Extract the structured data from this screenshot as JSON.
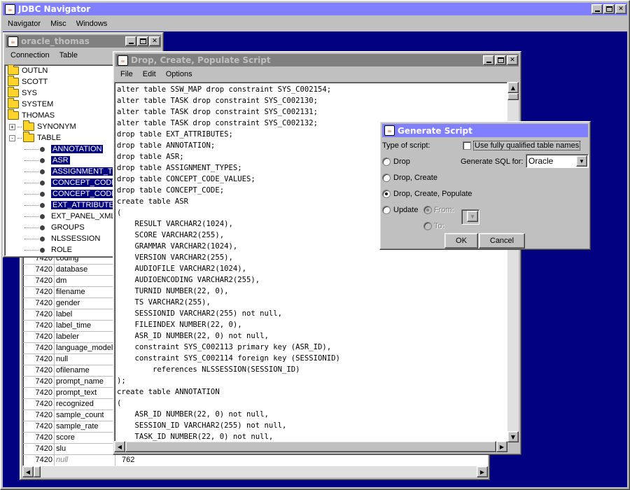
{
  "main": {
    "title": "JDBC Navigator",
    "menu": [
      "Navigator",
      "Misc",
      "Windows"
    ]
  },
  "oracle": {
    "title": "oracle_thomas",
    "menu": [
      "Connection",
      "Table"
    ],
    "tree": [
      {
        "label": "OUTLN",
        "kind": "folder",
        "level": 0
      },
      {
        "label": "SCOTT",
        "kind": "folder",
        "level": 0
      },
      {
        "label": "SYS",
        "kind": "folder",
        "level": 0
      },
      {
        "label": "SYSTEM",
        "kind": "folder",
        "level": 0
      },
      {
        "label": "THOMAS",
        "kind": "folder",
        "level": 0
      },
      {
        "label": "SYNONYM",
        "kind": "folder",
        "level": 1,
        "expander": "+"
      },
      {
        "label": "TABLE",
        "kind": "folder",
        "level": 1,
        "expander": "-"
      },
      {
        "label": "ANNOTATION",
        "kind": "leaf",
        "selected": true
      },
      {
        "label": "ASR",
        "kind": "leaf",
        "selected": true
      },
      {
        "label": "ASSIGNMENT_TYPES",
        "kind": "leaf",
        "selected": true
      },
      {
        "label": "CONCEPT_CODE",
        "kind": "leaf",
        "selected": true
      },
      {
        "label": "CONCEPT_CODE_VALUES",
        "kind": "leaf",
        "selected": true
      },
      {
        "label": "EXT_ATTRIBUTES",
        "kind": "leaf",
        "selected": true
      },
      {
        "label": "EXT_PANEL_XML",
        "kind": "leaf",
        "selected": false
      },
      {
        "label": "GROUPS",
        "kind": "leaf",
        "selected": false
      },
      {
        "label": "NLSSESSION",
        "kind": "leaf",
        "selected": false
      },
      {
        "label": "ROLE",
        "kind": "leaf",
        "selected": false
      }
    ]
  },
  "table": {
    "rows": [
      {
        "num": "7420",
        "name": "coding",
        "val": ""
      },
      {
        "num": "7420",
        "name": "database",
        "val": ""
      },
      {
        "num": "7420",
        "name": "dm",
        "val": ""
      },
      {
        "num": "7420",
        "name": "filename",
        "val": ""
      },
      {
        "num": "7420",
        "name": "gender",
        "val": ""
      },
      {
        "num": "7420",
        "name": "label",
        "val": ""
      },
      {
        "num": "7420",
        "name": "label_time",
        "val": ""
      },
      {
        "num": "7420",
        "name": "labeler",
        "val": ""
      },
      {
        "num": "7420",
        "name": "language_model",
        "val": ""
      },
      {
        "num": "7420",
        "name": "null",
        "val": ""
      },
      {
        "num": "7420",
        "name": "ofilename",
        "val": ""
      },
      {
        "num": "7420",
        "name": "prompt_name",
        "val": ""
      },
      {
        "num": "7420",
        "name": "prompt_text",
        "val": ""
      },
      {
        "num": "7420",
        "name": "recognized",
        "val": ""
      },
      {
        "num": "7420",
        "name": "sample_count",
        "val": ""
      },
      {
        "num": "7420",
        "name": "sample_rate",
        "val": ""
      },
      {
        "num": "7420",
        "name": "score",
        "val": ""
      },
      {
        "num": "7420",
        "name": "slu",
        "val": ""
      },
      {
        "num": "7420",
        "name": "null",
        "val": "762"
      }
    ]
  },
  "script": {
    "title": "Drop, Create, Populate Script",
    "menu": [
      "File",
      "Edit",
      "Options"
    ],
    "lines": [
      "alter table SSW_MAP drop constraint SYS_C002154;",
      "alter table TASK drop constraint SYS_C002130;",
      "alter table TASK drop constraint SYS_C002131;",
      "alter table TASK drop constraint SYS_C002132;",
      "drop table EXT_ATTRIBUTES;",
      "drop table ANNOTATION;",
      "drop table ASR;",
      "drop table ASSIGNMENT_TYPES;",
      "drop table CONCEPT_CODE_VALUES;",
      "drop table CONCEPT_CODE;",
      "create table ASR",
      "(",
      "    RESULT VARCHAR2(1024),",
      "    SCORE VARCHAR2(255),",
      "    GRAMMAR VARCHAR2(1024),",
      "    VERSION VARCHAR2(255),",
      "    AUDIOFILE VARCHAR2(1024),",
      "    AUDIOENCODING VARCHAR2(255),",
      "    TURNID NUMBER(22, 0),",
      "    TS VARCHAR2(255),",
      "    SESSIONID VARCHAR2(255) not null,",
      "    FILEINDEX NUMBER(22, 0),",
      "    ASR_ID NUMBER(22, 0) not null,",
      "    constraint SYS_C002113 primary key (ASR_ID),",
      "    constraint SYS_C002114 foreign key (SESSIONID)",
      "        references NLSSESSION(SESSION_ID)",
      ");",
      "create table ANNOTATION",
      "(",
      "    ASR_ID NUMBER(22, 0) not null,",
      "    SESSION_ID VARCHAR2(255) not null,",
      "    TASK_ID NUMBER(22, 0) not null,"
    ]
  },
  "dialog": {
    "title": "Generate Script",
    "type_label": "Type of script:",
    "qualified_label": "Use fully qualified table names",
    "sql_for_label": "Generate SQL for:",
    "sql_for_value": "Oracle",
    "opt_drop": "Drop",
    "opt_drop_create": "Drop, Create",
    "opt_drop_create_populate": "Drop, Create, Populate",
    "opt_update": "Update",
    "from_label": "From:",
    "to_label": "To:",
    "ok": "OK",
    "cancel": "Cancel"
  }
}
